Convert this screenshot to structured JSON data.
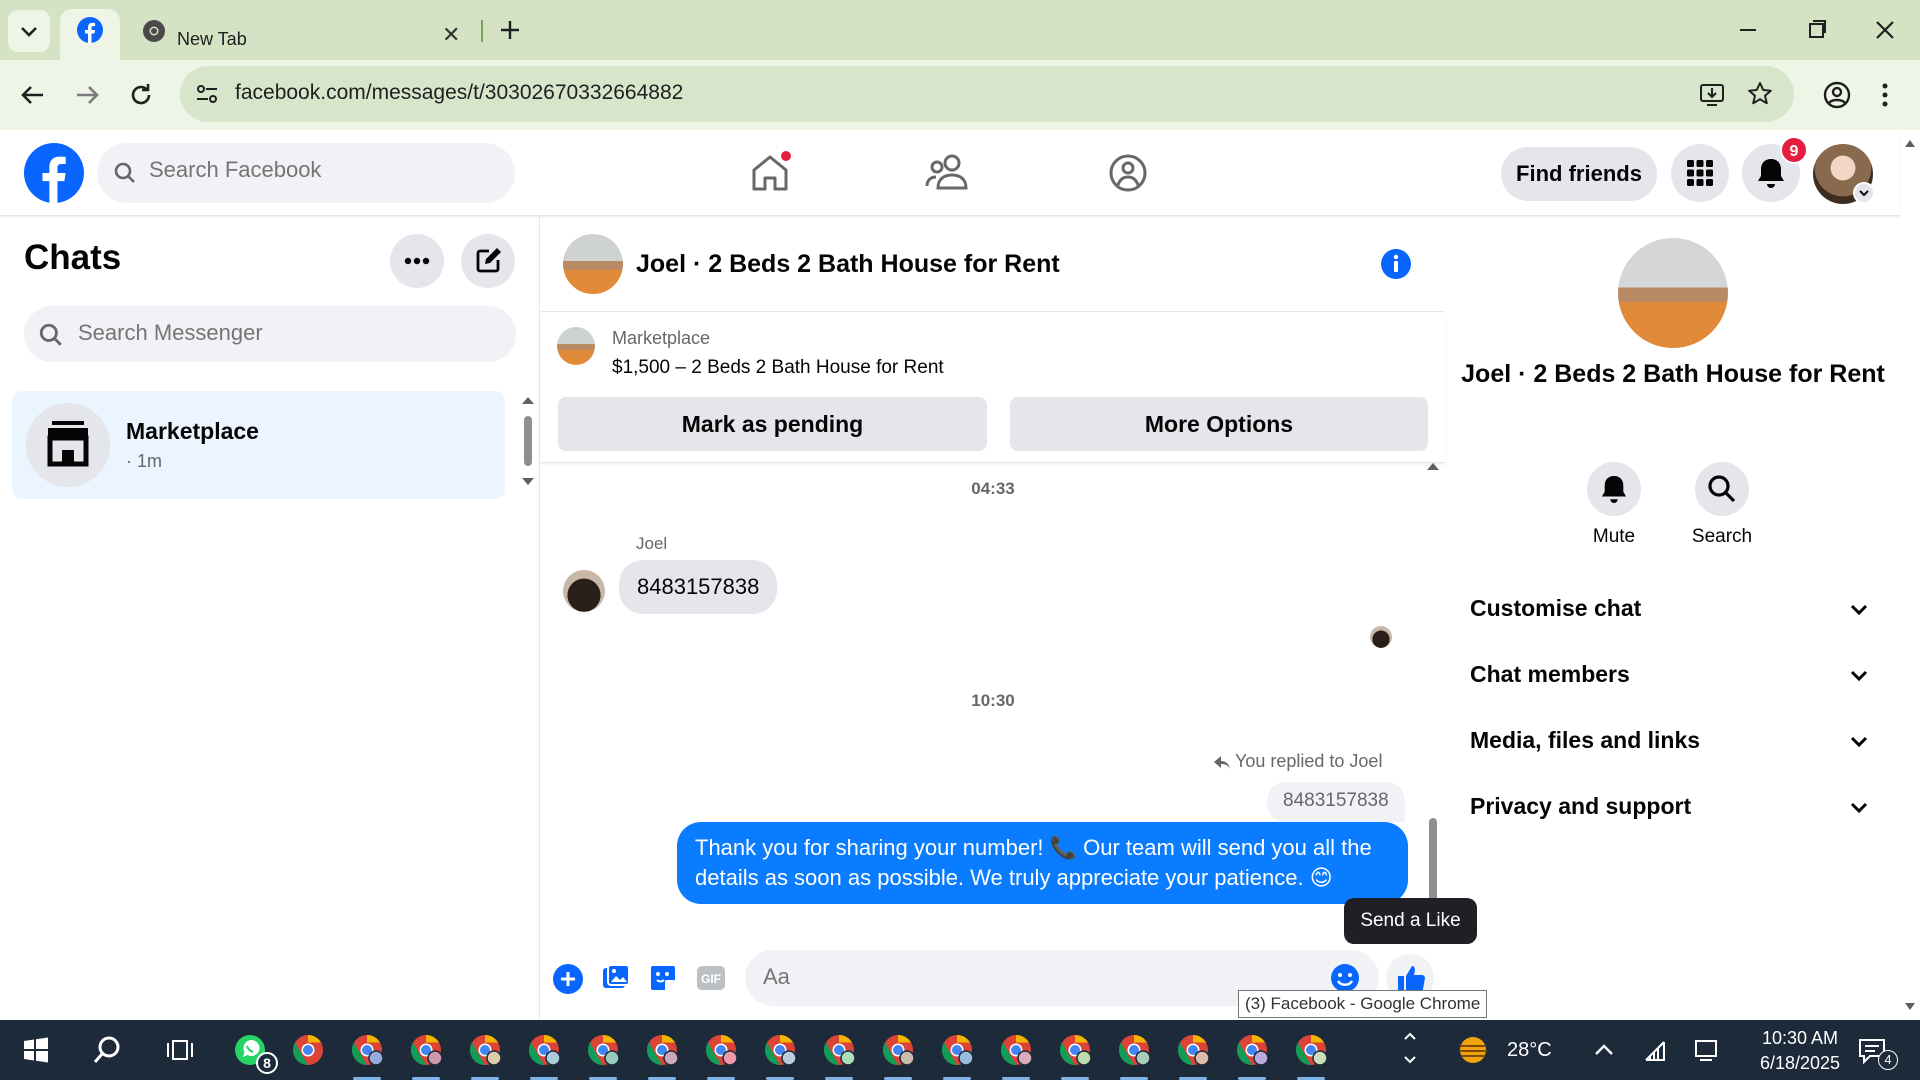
{
  "browser": {
    "tabs": [
      {
        "label": "",
        "icon": "facebook-icon",
        "active": true
      },
      {
        "label": "New Tab",
        "icon": "chrome-icon",
        "active": false
      }
    ],
    "url": "facebook.com/messages/t/30302670332664882",
    "tooltip": "(3) Facebook - Google Chrome"
  },
  "facebook": {
    "search_placeholder": "Search Facebook",
    "find_friends": "Find friends",
    "notifications_count": "9"
  },
  "chats": {
    "title": "Chats",
    "search_placeholder": "Search Messenger",
    "items": [
      {
        "name": "Marketplace",
        "time": "· 1m"
      }
    ]
  },
  "conversation": {
    "title": "Joel · 2 Beds 2 Bath House for Rent",
    "marketplace": {
      "label": "Marketplace",
      "listing": "$1,500 – 2 Beds 2 Bath House for Rent",
      "pending_button": "Mark as pending",
      "options_button": "More Options"
    },
    "messages": [
      {
        "type": "timestamp",
        "text": "04:33"
      },
      {
        "type": "incoming",
        "sender": "Joel",
        "text": "8483157838"
      },
      {
        "type": "timestamp",
        "text": "10:30"
      },
      {
        "type": "reply-note",
        "text": "You replied to Joel"
      },
      {
        "type": "quoted",
        "text": "8483157838"
      },
      {
        "type": "outgoing",
        "text": "Thank you for sharing your number! 📞 Our team will send you all the details as soon as possible. We truly appreciate your patience. 😊"
      }
    ],
    "composer_placeholder": "Aa",
    "like_tooltip": "Send a Like"
  },
  "info_panel": {
    "name": "Joel · 2 Beds 2 Bath House for Rent",
    "actions": [
      {
        "label": "Mute",
        "icon": "bell-icon"
      },
      {
        "label": "Search",
        "icon": "search-icon"
      }
    ],
    "sections": [
      {
        "label": "Customise chat"
      },
      {
        "label": "Chat members"
      },
      {
        "label": "Media, files and links"
      },
      {
        "label": "Privacy and support"
      }
    ]
  },
  "taskbar": {
    "whatsapp_badge": "8",
    "temperature": "28°C",
    "time": "10:30 AM",
    "date": "6/18/2025",
    "notification_count": "4"
  },
  "colors": {
    "facebook_blue": "#0866ff",
    "message_blue": "#0a7cff",
    "chrome_frame": "#d3e3c4",
    "badge_red": "#e41e3f"
  }
}
